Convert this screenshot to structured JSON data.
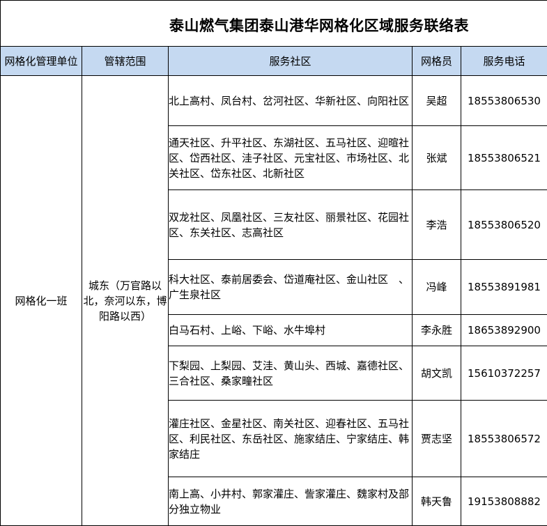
{
  "title": "泰山燃气集团泰山港华网格化区域服务联络表",
  "headers": {
    "unit": "网格化管理单位",
    "range": "管辖范围",
    "community": "服务社区",
    "member": "网格员",
    "phone": "服务电话"
  },
  "unit": "网格化一班",
  "range": "城东（万官路以北，奈河以东，博阳路以西）",
  "rows": [
    {
      "community": "北上高村、凤台村、岔河社区、华新社区、向阳社区",
      "member": "吴超",
      "phone": "18553806530"
    },
    {
      "community": "通天社区、升平社区、东湖社区、五马社区、迎暄社区、岱西社区、洼子社区、元宝社区、市场社区、北关社区、岱东社区、北新社区",
      "member": "张斌",
      "phone": "18553806521"
    },
    {
      "community": "双龙社区、凤凰社区、三友社区、丽景社区、花园社区、东关社区、志高社区",
      "member": "李浩",
      "phone": "18553806520"
    },
    {
      "community": "科大社区、泰前居委会、岱道庵社区、金山社区　、广生泉社区",
      "member": "冯峰",
      "phone": "18553891981"
    },
    {
      "community": "白马石村、上峪、下峪、水牛埠村",
      "member": "李永胜",
      "phone": "18653892900"
    },
    {
      "community": "下梨园、上梨园、艾洼、黄山头、西城、嘉德社区、三合社区、桑家疃社区",
      "member": "胡文凯",
      "phone": "15610372257"
    },
    {
      "community": "灌庄社区、金星社区、南关社区、迎春社区、五马社区、利民社区、东岳社区、施家结庄、宁家结庄、韩家结庄",
      "member": "贾志坚",
      "phone": "18553806572"
    },
    {
      "community": "南上高、小井村、郭家灌庄、訾家灌庄、魏家村及部分独立物业",
      "member": "韩天鲁",
      "phone": "19153808882"
    }
  ]
}
